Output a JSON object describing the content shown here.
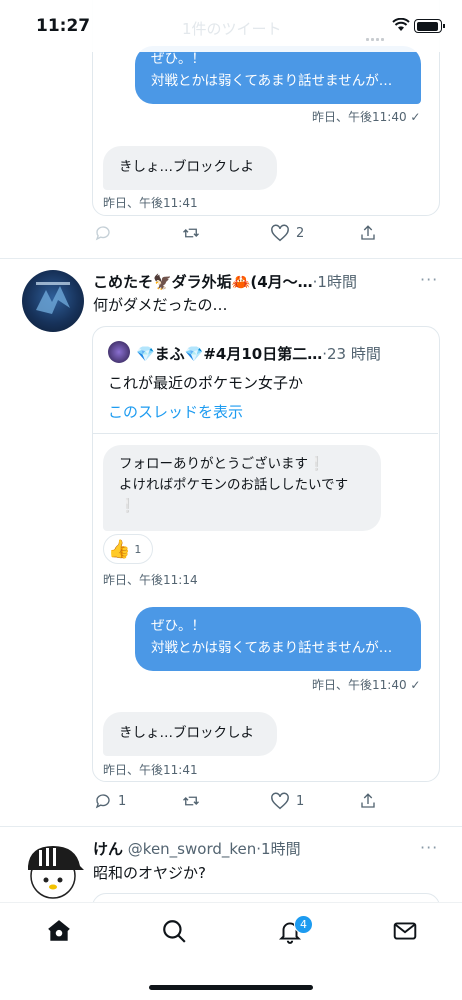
{
  "status": {
    "time": "11:27",
    "faint_title": "1件のツイート"
  },
  "top_thread": {
    "outgoing": {
      "line1": "ぜひ。！",
      "line2": "対戦とかは弱くてあまり話せませんが…",
      "meta": "昨日、午後11:40"
    },
    "incoming": {
      "text": "きしょ…ブロックしよ",
      "meta": "昨日、午後11:41"
    },
    "actions": {
      "like_count": "2"
    }
  },
  "tweet1": {
    "name": "こめたそ🦅ダラ外垢🦀(4月〜…",
    "time": "·1時間",
    "text": "何がダメだったの…",
    "quote": {
      "name": "💎まふ💎#4月10日第二…",
      "time": "·23 時間",
      "text": "これが最近のポケモン女子か",
      "link": "このスレッドを表示",
      "incoming1": {
        "line1": "フォローありがとうございます❕",
        "line2": "よければポケモンのお話ししたいです",
        "line3": "❕"
      },
      "reaction": {
        "emoji": "👍",
        "count": "1"
      },
      "meta1": "昨日、午後11:14",
      "outgoing": {
        "line1": "ぜひ。！",
        "line2": "対戦とかは弱くてあまり話せませんが…",
        "meta": "昨日、午後11:40"
      },
      "incoming2": {
        "text": "きしょ…ブロックしよ",
        "meta": "昨日、午後11:41"
      }
    },
    "actions": {
      "reply_count": "1",
      "like_count": "1"
    }
  },
  "tweet2": {
    "name": "けん",
    "handle": "@ken_sword_ken",
    "time": "·1時間",
    "text": "昭和のオヤジか?"
  },
  "tabbar": {
    "notification_badge": "4"
  },
  "colors": {
    "accent": "#1d9bf0",
    "bubble": "#4b98e6",
    "muted": "#536471"
  }
}
